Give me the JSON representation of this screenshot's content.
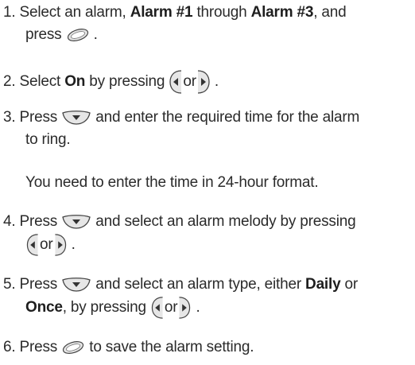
{
  "steps": {
    "s1": {
      "num": "1.",
      "t1": " Select an alarm, ",
      "b1": "Alarm #1",
      "t2": " through ",
      "b2": "Alarm #3",
      "t3": ", and",
      "t4": "press ",
      "t5": " ."
    },
    "s2": {
      "num": "2.",
      "t1": " Select ",
      "b1": "On",
      "t2": " by pressing ",
      "or": "or",
      "t3": " ."
    },
    "s3": {
      "num": "3.",
      "t1": " Press ",
      "t2": " and enter the required time for the alarm",
      "t3": "to ring."
    },
    "note": "You need to enter the time in 24-hour format.",
    "s4": {
      "num": "4.",
      "t1": " Press ",
      "t2": " and select an alarm melody by pressing",
      "or": "or",
      "t3": " ."
    },
    "s5": {
      "num": "5.",
      "t1": " Press ",
      "t2": " and select an alarm type, either ",
      "b1": "Daily",
      "t3": " or",
      "b2": "Once",
      "t4": ", by pressing ",
      "or": "or",
      "t5": " ."
    },
    "s6": {
      "num": "6.",
      "t1": " Press ",
      "t2": " to save the alarm setting."
    }
  },
  "icons": {
    "menu_ok": "menu-ok-key-icon",
    "nav_down": "navigation-down-key-icon",
    "nav_left": "navigation-left-key-icon",
    "nav_right": "navigation-right-key-icon"
  }
}
